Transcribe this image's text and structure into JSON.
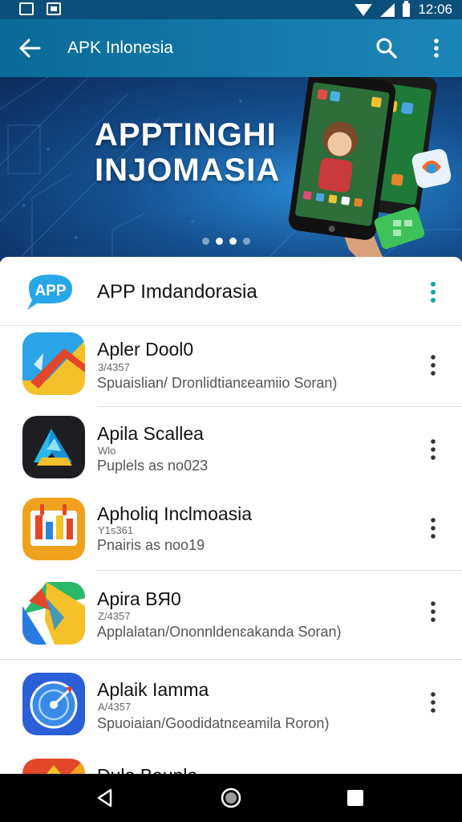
{
  "status_bar": {
    "time": "12:06",
    "icons": [
      "gallery-notification-icon",
      "photo-notification-icon",
      "wifi-icon",
      "signal-icon",
      "battery-icon"
    ]
  },
  "app_bar": {
    "title": "APK Inlonesia",
    "icons": [
      "back-arrow-icon",
      "search-icon",
      "more-vert-icon"
    ]
  },
  "banner": {
    "title_line1": "APPTINGHI",
    "title_line2": "INJOMASIA",
    "page_count": 3,
    "active_page": 2
  },
  "header": {
    "logo_text": "APP",
    "title": "APP Imdandorasia"
  },
  "apps": [
    {
      "name": "Apler Dool0",
      "sub": "3/4357",
      "desc": "Spuaislian/ Dronlidtianɛeamiio Soran)"
    },
    {
      "name": "Apila Scallea",
      "sub": "Wlo",
      "desc": "Puplels as no023"
    },
    {
      "name": "Apholiq Inclmoasia",
      "sub": "Y1s361",
      "desc": "Pnairis as noo19"
    },
    {
      "name": "Apira BЯ0",
      "sub": "Z/4357",
      "desc": "Applalatan/Ononnldenɛakanda Soran)"
    },
    {
      "name": "Aplaik Iamma",
      "sub": "A/4357",
      "desc": "Spuoiaian/Goodidatnɛeamila Roron)"
    },
    {
      "name": "Dulo Baunla",
      "sub": "",
      "desc": ""
    }
  ],
  "colors": {
    "appbar": "#0a6a98",
    "statusbar": "#0c4f7a",
    "accent": "#1aa3a8",
    "navbar": "#000000"
  },
  "nav_bar": {
    "icons": [
      "nav-back-icon",
      "nav-home-icon",
      "nav-recents-icon"
    ]
  }
}
